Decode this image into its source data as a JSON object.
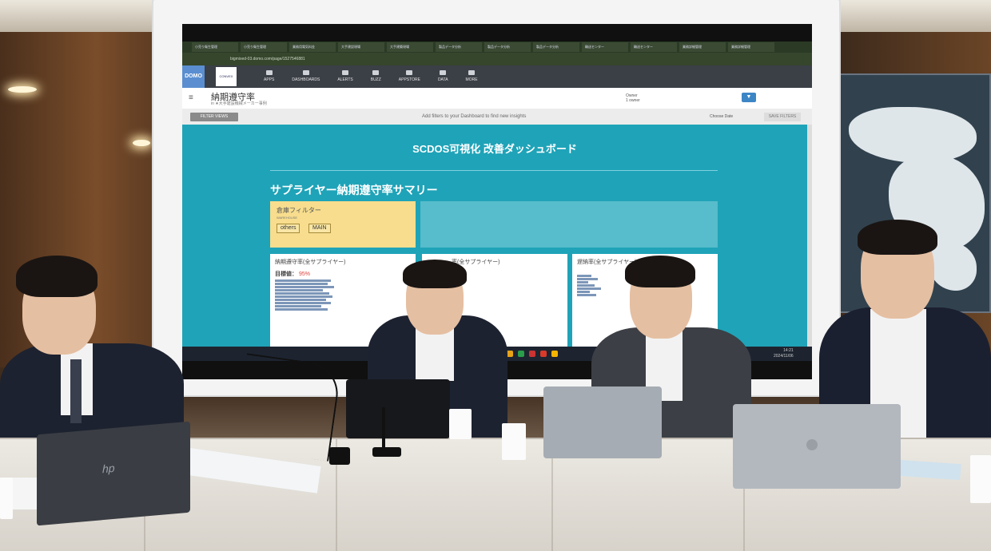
{
  "browser": {
    "tabs": [
      "小売り衛生管理",
      "小売り衛生管理",
      "業務用電気料金",
      "大手建設現場",
      "大手建築現場",
      "製品データ分析",
      "製品データ分析",
      "製品データ分析",
      "輸送センター",
      "輸送センター",
      "業務詳細管理",
      "業務詳細管理"
    ],
    "url": "bigmixed-03.domo.com/page/1527546881"
  },
  "domo_nav": {
    "logo": "DOMO",
    "partner_logo": "CONVEX",
    "items": [
      "APPS",
      "DASHBOARDS",
      "ALERTS",
      "BUZZ",
      "APPSTORE",
      "DATA",
      "MORE"
    ]
  },
  "page_header": {
    "title": "納期遵守率",
    "subtitle": "in ★大手建設機械メーカー事例",
    "owner_label": "Owner",
    "owner_value": "1 owner"
  },
  "filter_bar": {
    "filter_views": "FILTER VIEWS",
    "hint": "Add filters to your Dashboard to find new insights",
    "choose_date": "Choose Date",
    "save_filters": "SAVE FILTERS"
  },
  "dashboard": {
    "title": "SCDOS可視化 改善ダッシュボード",
    "section_title": "サプライヤー納期遵守率サマリー",
    "filter_card": {
      "label": "倉庫フィルター",
      "sub": "WAREHOUSE",
      "chips": [
        "others",
        "MAIN"
      ]
    },
    "cards": [
      {
        "title": "納期遵守率(全サプライヤー)",
        "target_label": "目標値：",
        "target_value": "95%"
      },
      {
        "title": "…率(全サプライヤー)"
      },
      {
        "title": "遅納率(全サプライヤー)"
      }
    ]
  },
  "taskbar": {
    "time": "14:21",
    "date": "2024/11/06"
  },
  "laptops": {
    "left_brand": "hp"
  },
  "colors": {
    "dashboard_bg": "#1fa3b8",
    "filter_card": "#f7dd8d",
    "target_red": "#e0443b",
    "nav_bg": "#3b3f46",
    "filter_button": "#3d86c6"
  }
}
